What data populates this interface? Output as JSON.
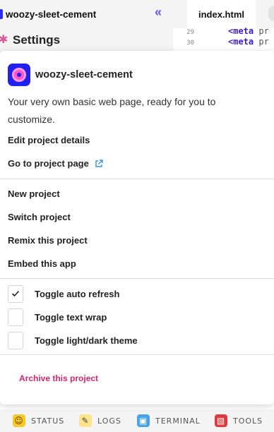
{
  "editor": {
    "project_name": "woozy-sleet-cement",
    "tab_label": "index.html",
    "sidebar_title": "Settings",
    "code_lines": [
      {
        "num": "29",
        "tag": "<meta",
        "rest": " pr"
      },
      {
        "num": "30",
        "tag": "<meta",
        "rest": " pr"
      }
    ]
  },
  "popover": {
    "project_name": "woozy-sleet-cement",
    "description": "Your very own basic web page, ready for you to customize.",
    "edit_details": "Edit project details",
    "go_to_page": "Go to project page",
    "new_project": "New project",
    "switch_project": "Switch project",
    "remix_project": "Remix this project",
    "embed_app": "Embed this app",
    "toggles": [
      {
        "label": "Toggle auto refresh",
        "checked": true
      },
      {
        "label": "Toggle text wrap",
        "checked": false
      },
      {
        "label": "Toggle light/dark theme",
        "checked": false
      }
    ],
    "archive": "Archive this project"
  },
  "statusbar": {
    "status": "STATUS",
    "logs": "LOGS",
    "terminal": "TERMINAL",
    "tools": "TOOLS"
  },
  "colors": {
    "accent_purple": "#6f4bff",
    "archive_red": "#d6246e",
    "link_blue": "#3b8ee6",
    "avatar_blue": "#2020f0",
    "avatar_pink": "#ff52c9"
  }
}
